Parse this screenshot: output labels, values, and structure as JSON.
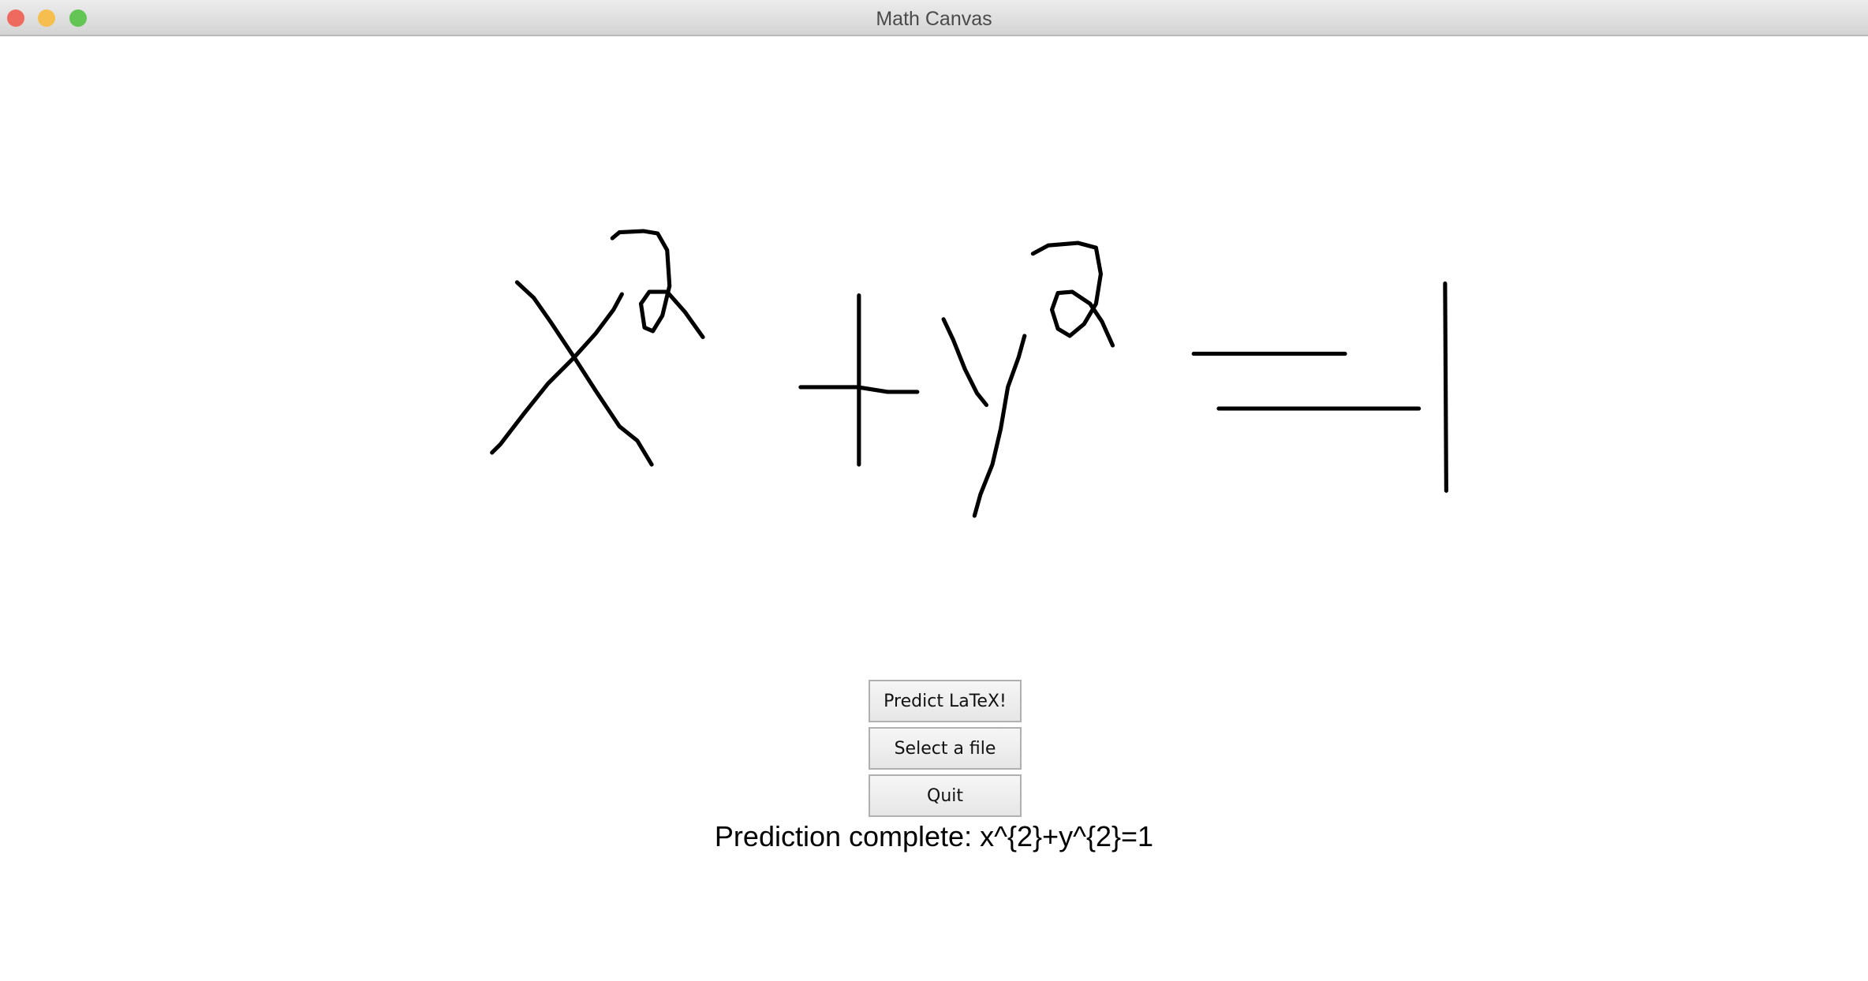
{
  "window": {
    "title": "Math Canvas",
    "controls": {
      "close_color": "#ee6a5f",
      "minimize_color": "#f5be4f",
      "maximize_color": "#62c554"
    }
  },
  "buttons": {
    "predict": "Predict LaTeX!",
    "select_file": "Select a file",
    "quit": "Quit"
  },
  "status": "Prediction complete: x^{2}+y^{2}=1"
}
